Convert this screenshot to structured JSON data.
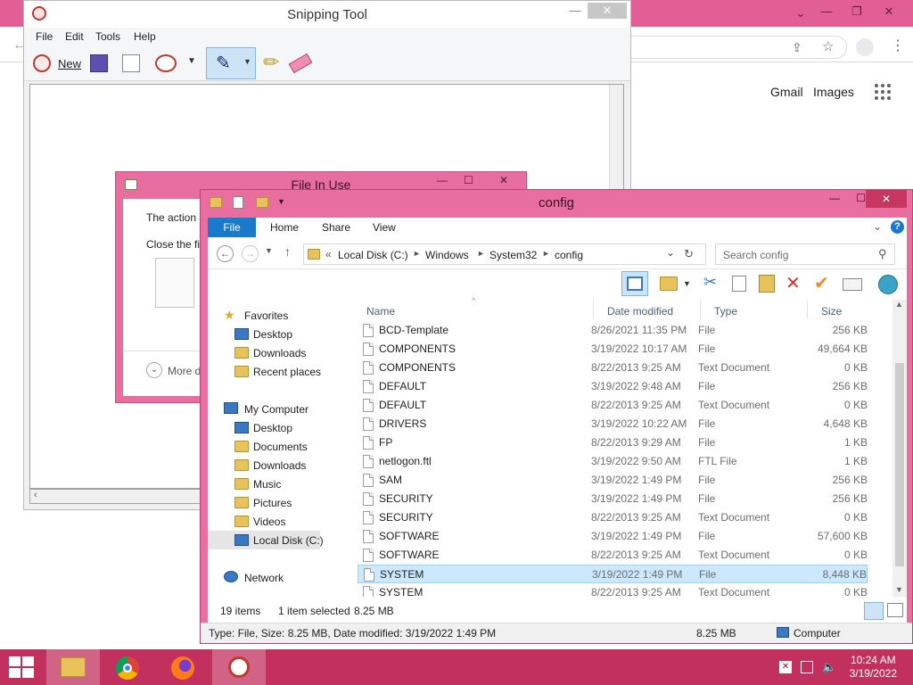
{
  "chrome": {
    "links": [
      "Gmail",
      "Images"
    ]
  },
  "snipping_tool": {
    "title": "Snipping Tool",
    "menu": [
      "File",
      "Edit",
      "Tools",
      "Help"
    ],
    "new_label": "New"
  },
  "file_in_use": {
    "title": "File In Use",
    "line1": "The action c",
    "line2": "Close the fil",
    "more": "More d"
  },
  "explorer": {
    "title": "config",
    "tabs": [
      "File",
      "Home",
      "Share",
      "View"
    ],
    "breadcrumb": [
      "Local Disk (C:)",
      "Windows",
      "System32",
      "config"
    ],
    "search_placeholder": "Search config",
    "columns": [
      "Name",
      "Date modified",
      "Type",
      "Size"
    ],
    "files": [
      {
        "name": "BCD-Template",
        "date": "8/26/2021 11:35 PM",
        "type": "File",
        "size": "256 KB"
      },
      {
        "name": "COMPONENTS",
        "date": "3/19/2022 10:17 AM",
        "type": "File",
        "size": "49,664 KB"
      },
      {
        "name": "COMPONENTS",
        "date": "8/22/2013 9:25 AM",
        "type": "Text Document",
        "size": "0 KB"
      },
      {
        "name": "DEFAULT",
        "date": "3/19/2022 9:48 AM",
        "type": "File",
        "size": "256 KB"
      },
      {
        "name": "DEFAULT",
        "date": "8/22/2013 9:25 AM",
        "type": "Text Document",
        "size": "0 KB"
      },
      {
        "name": "DRIVERS",
        "date": "3/19/2022 10:22 AM",
        "type": "File",
        "size": "4,648 KB"
      },
      {
        "name": "FP",
        "date": "8/22/2013 9:29 AM",
        "type": "File",
        "size": "1 KB"
      },
      {
        "name": "netlogon.ftl",
        "date": "3/19/2022 9:50 AM",
        "type": "FTL File",
        "size": "1 KB"
      },
      {
        "name": "SAM",
        "date": "3/19/2022 1:49 PM",
        "type": "File",
        "size": "256 KB"
      },
      {
        "name": "SECURITY",
        "date": "3/19/2022 1:49 PM",
        "type": "File",
        "size": "256 KB"
      },
      {
        "name": "SECURITY",
        "date": "8/22/2013 9:25 AM",
        "type": "Text Document",
        "size": "0 KB"
      },
      {
        "name": "SOFTWARE",
        "date": "3/19/2022 1:49 PM",
        "type": "File",
        "size": "57,600 KB"
      },
      {
        "name": "SOFTWARE",
        "date": "8/22/2013 9:25 AM",
        "type": "Text Document",
        "size": "0 KB"
      },
      {
        "name": "SYSTEM",
        "date": "3/19/2022 1:49 PM",
        "type": "File",
        "size": "8,448 KB",
        "selected": true
      },
      {
        "name": "SYSTEM",
        "date": "8/22/2013 9:25 AM",
        "type": "Text Document",
        "size": "0 KB"
      }
    ],
    "nav": {
      "favorites": "Favorites",
      "favorites_items": [
        "Desktop",
        "Downloads",
        "Recent places"
      ],
      "computer": "My Computer",
      "computer_items": [
        "Desktop",
        "Documents",
        "Downloads",
        "Music",
        "Pictures",
        "Videos",
        "Local Disk (C:)"
      ],
      "network": "Network"
    },
    "status": {
      "items": "19 items",
      "selected": "1 item selected",
      "selected_size": "8.25 MB",
      "details": "Type: File, Size: 8.25 MB, Date modified: 3/19/2022 1:49 PM",
      "size": "8.25 MB",
      "location": "Computer"
    }
  },
  "taskbar": {
    "time": "10:24 AM",
    "date": "3/19/2022"
  },
  "colors": {
    "accent": "#e96ea0",
    "taskbar": "#c2315e",
    "selection": "#cce8ff"
  }
}
